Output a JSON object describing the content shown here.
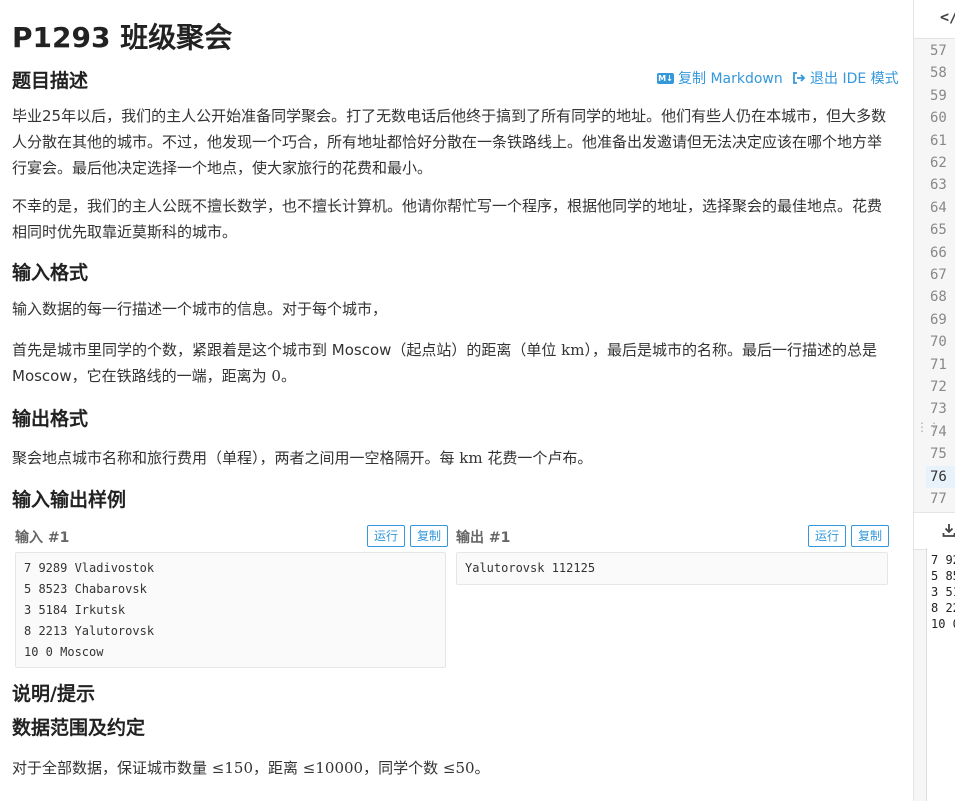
{
  "title": "P1293 班级聚会",
  "sections": {
    "description_heading": "题目描述",
    "input_heading": "输入格式",
    "output_heading": "输出格式",
    "samples_heading": "输入输出样例",
    "hint_heading": "说明/提示",
    "range_heading": "数据范围及约定"
  },
  "links": {
    "copy_markdown": "复制 Markdown",
    "exit_ide": "退出 IDE 模式"
  },
  "description": {
    "p1": "毕业25年以后，我们的主人公开始准备同学聚会。打了无数电话后他终于搞到了所有同学的地址。他们有些人仍在本城市，但大多数人分散在其他的城市。不过，他发现一个巧合，所有地址都恰好分散在一条铁路线上。他准备出发邀请但无法决定应该在哪个地方举行宴会。最后他决定选择一个地点，使大家旅行的花费和最小。",
    "p2": "不幸的是，我们的主人公既不擅长数学，也不擅长计算机。他请你帮忙写一个程序，根据他同学的地址，选择聚会的最佳地点。花费相同时优先取靠近莫斯科的城市。"
  },
  "input_format": {
    "p1": "输入数据的每一行描述一个城市的信息。对于每个城市，",
    "p2a": "首先是城市里同学的个数，紧跟着是这个城市到 Moscow（起点站）的距离（单位 ",
    "unit_km": "km",
    "p2b": "），最后是城市的名称。最后一行描述的总是 Moscow，它在铁路线的一端，距离为 ",
    "zero": "0",
    "p2c": "。"
  },
  "output_format": {
    "p1a": "聚会地点城市名称和旅行费用（单程），两者之间用一空格隔开。每 ",
    "unit_km": "km",
    "p1b": " 花费一个卢布。"
  },
  "samples": {
    "input_label": "输入 #1",
    "output_label": "输出 #1",
    "run_label": "运行",
    "copy_label": "复制",
    "input_lines": [
      "7 9289 Vladivostok",
      "5 8523 Chabarovsk",
      "3 5184 Irkutsk",
      "8 2213 Yalutorovsk",
      "10 0 Moscow"
    ],
    "output_lines": [
      "Yalutorovsk 112125"
    ]
  },
  "range": {
    "a": "对于全部数据，保证城市数量 ",
    "leq": "≤",
    "n1": "150",
    "b": "，距离 ",
    "n2": "10000",
    "c": "，同学个数 ",
    "n3": "50",
    "d": "。"
  },
  "ide": {
    "code_icon": "</",
    "line_numbers": [
      "57",
      "58",
      "59",
      "60",
      "61",
      "62",
      "63",
      "64",
      "65",
      "66",
      "67",
      "68",
      "69",
      "70",
      "71",
      "72",
      "73",
      "74",
      "75",
      "76",
      "77"
    ],
    "active_line": "76",
    "input_preview": [
      "7 92",
      "5 85",
      "3 51",
      "8 22",
      "10 0"
    ]
  },
  "colors": {
    "accent": "#3498db",
    "code_bg": "#fafafa",
    "active_line_bg": "#e8f2fb"
  }
}
